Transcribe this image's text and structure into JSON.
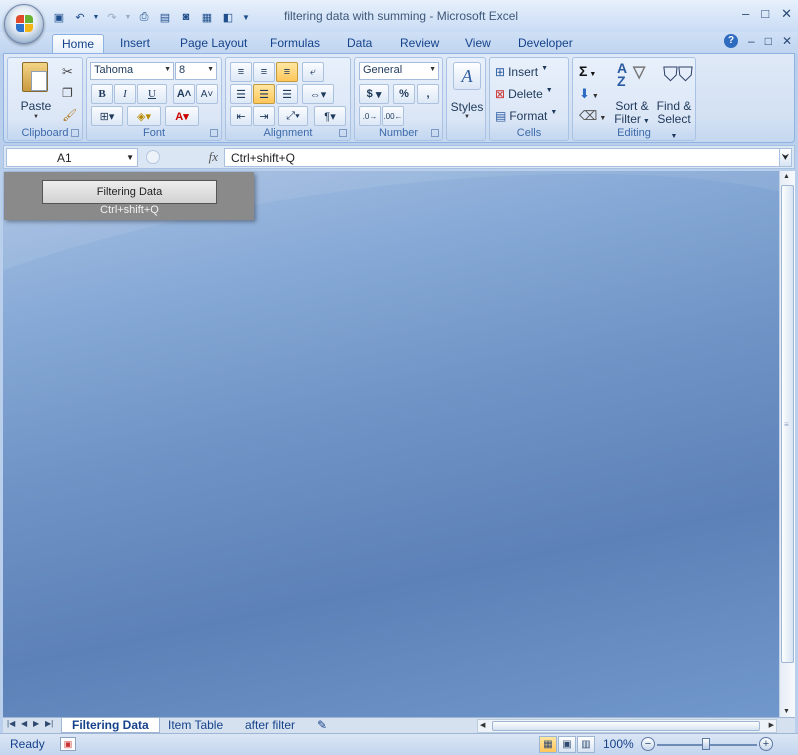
{
  "window": {
    "title": "filtering data with summing - Microsoft Excel",
    "controls": [
      "–",
      "□",
      "✕"
    ]
  },
  "qat": {
    "items": [
      "save-icon",
      "undo-icon",
      "redo-icon",
      "print-preview-icon",
      "open-icon",
      "camera-icon",
      "form-icon",
      "customize-icon"
    ]
  },
  "tabs": [
    {
      "label": "Home",
      "active": true
    },
    {
      "label": "Insert"
    },
    {
      "label": "Page Layout"
    },
    {
      "label": "Formulas"
    },
    {
      "label": "Data"
    },
    {
      "label": "Review"
    },
    {
      "label": "View"
    },
    {
      "label": "Developer"
    }
  ],
  "ribbon": {
    "clipboard": {
      "label": "Clipboard",
      "paste": "Paste"
    },
    "font": {
      "label": "Font",
      "name": "Tahoma",
      "size": "8",
      "bold": "B",
      "italic": "I",
      "underline": "U"
    },
    "alignment": {
      "label": "Alignment"
    },
    "number": {
      "label": "Number",
      "format": "General",
      "currency": "$",
      "percent": "%",
      "comma": ","
    },
    "styles": {
      "label": "Styles"
    },
    "cells": {
      "label": "Cells",
      "insert": "Insert",
      "delete": "Delete",
      "format": "Format"
    },
    "editing": {
      "label": "Editing",
      "sort_line1": "Sort &",
      "sort_line2": "Filter",
      "find_line1": "Find &",
      "find_line2": "Select",
      "sum": "Σ"
    }
  },
  "formula_bar": {
    "name_box": "A1",
    "fx": "fx",
    "formula": "Ctrl+shift+Q"
  },
  "float_panel": {
    "button_label": "Filtering Data",
    "hint": "Ctrl+shift+Q"
  },
  "sheet_tabs": [
    {
      "label": "Filtering Data",
      "active": true
    },
    {
      "label": "Item Table"
    },
    {
      "label": "after filter"
    }
  ],
  "status": {
    "ready": "Ready",
    "zoom": "100%"
  }
}
